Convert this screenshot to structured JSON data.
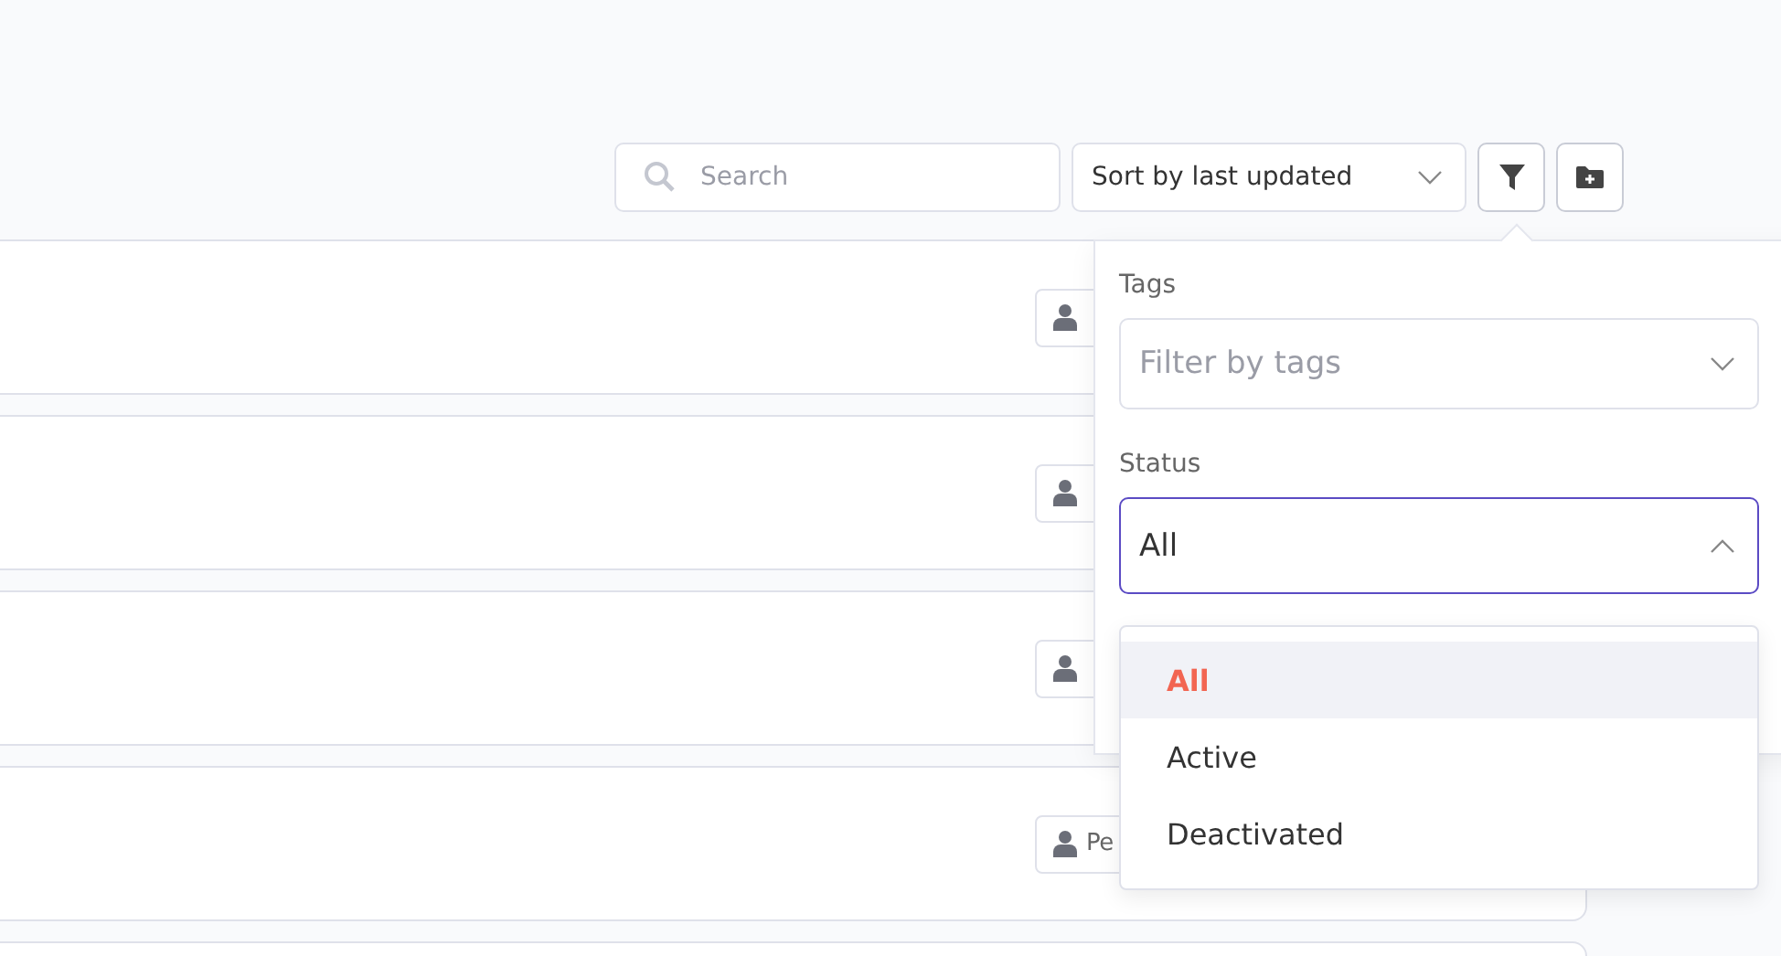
{
  "toolbar": {
    "search": {
      "placeholder": "Search"
    },
    "sort": {
      "value": "Sort by last updated"
    }
  },
  "cards": [
    {
      "kind": "owner-icon"
    },
    {
      "kind": "owner-icon"
    },
    {
      "kind": "owner-icon"
    },
    {
      "kind": "owner-label",
      "owner": "Pe"
    },
    {
      "kind": "empty"
    }
  ],
  "filter_panel": {
    "tags": {
      "label": "Tags",
      "placeholder": "Filter by tags"
    },
    "status": {
      "label": "Status",
      "value": "All",
      "expanded": true,
      "options": [
        {
          "label": "All",
          "selected": true
        },
        {
          "label": "Active",
          "selected": false
        },
        {
          "label": "Deactivated",
          "selected": false
        }
      ]
    }
  }
}
